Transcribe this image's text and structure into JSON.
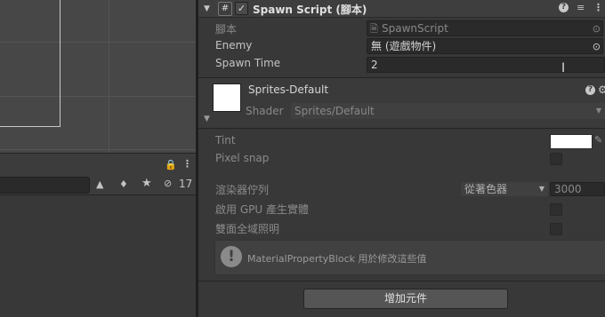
{
  "component": {
    "title": "Spawn Script (腳本)",
    "script_label": "腳本",
    "script_value": "SpawnScript",
    "enemy_label": "Enemy",
    "enemy_value": "無 (遊戲物件)",
    "spawn_time_label": "Spawn Time",
    "spawn_time_value": "2"
  },
  "material": {
    "name": "Sprites-Default",
    "shader_label": "Shader",
    "shader_value": "Sprites/Default"
  },
  "properties": {
    "tint_label": "Tint",
    "pixel_snap_label": "Pixel snap",
    "sorting_label": "渲染器佇列",
    "sorting_mode": "從著色器",
    "sorting_value": "3000",
    "gpu_label": "啟用 GPU 產生實體",
    "double_sided_label": "雙面全域照明",
    "info_text": "MaterialPropertyBlock 用於修改這些值"
  },
  "add_component_label": "增加元件",
  "hierarchy": {
    "hidden_count": "17"
  },
  "colors": {
    "tint": "#ffffff",
    "accent_check": "#cfcfcf"
  }
}
